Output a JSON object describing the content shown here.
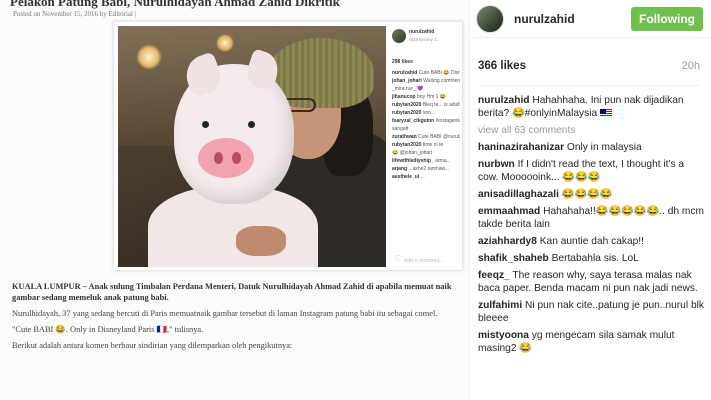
{
  "article": {
    "headline_partial": "Pelakon Patung Babi, Nurulhidayah Ahmad Zahid Dikritik",
    "posted": "Posted on November 15, 2016 by Editorial |",
    "paragraphs": [
      "KUALA LUMPUR – Anak sulung Timbalan Perdana Menteri, Datuk Nurulhidayah Ahmad Zahid di apabila memuat naik gambar sedang memeluk anak patung babi.",
      "Nurulhidayah, 37 yang sedang bercuti di Paris memuatnaik gambar tersebut di laman Instagram patung babi itu sebagai comel.",
      "\"Cute BABI 😂. Only in Disneyland Paris 🇫🇷,\" tulisnya.",
      "Berikut adalah antara komen berbaur sindirian yang dilemparkan oleh pengikutnya:"
    ]
  },
  "embedded_post": {
    "username": "nurulzahid",
    "location": "Walt Disney S...",
    "likes": "298 likes",
    "comments": [
      {
        "u": "nurulzahid",
        "t": "Cute BABI 😂 Disneyland Paris re..."
      },
      {
        "u": "johan_johari",
        "t": "Waiting comments in 3, 2, 1..."
      },
      {
        "u": "",
        "t": "_mira.nur_ 💜"
      },
      {
        "u": "jihanucop",
        "t": "boy Hm 1 😂"
      },
      {
        "u": "rubytan2020",
        "t": "Bleq te... is adult"
      },
      {
        "u": "rubytan2020",
        "t": "soo..."
      },
      {
        "u": "fsaryzal_ctkguinn",
        "t": "#instagenius academ..."
      },
      {
        "u": "",
        "t": "sangatt"
      },
      {
        "u": "zurathwan",
        "t": "Cute BABI @nurulzahid"
      },
      {
        "u": "rubytan2020",
        "t": "time ni te"
      },
      {
        "u": "",
        "t": "😂 @johan_johari"
      },
      {
        "u": "lifewithlediyship_",
        "t": "arma..."
      },
      {
        "u": "arjang",
        "t": "...akhe2 tanmaw..."
      },
      {
        "u": "aesthele_ul",
        "t": "..."
      }
    ],
    "add_comment": "Add a comment..."
  },
  "header": {
    "username": "nurulzahid",
    "follow_label": "Following"
  },
  "post": {
    "likes": "366 likes",
    "time": "20h",
    "view_all": "view all 63 comments"
  },
  "comments": [
    {
      "user": "nurulzahid",
      "text": "Hahahhaha. Ini pun nak dijadikan berita? 😂#onlyinMalaysia",
      "flag": true
    },
    {
      "user": "haninazirahanizar",
      "text": "Only in malaysia"
    },
    {
      "user": "nurbwn",
      "text": "If I didn't read the text, I thought it's a cow. Moooooink... 😂😂😂"
    },
    {
      "user": "anisadillaghazali",
      "text": "😂😂😂😂"
    },
    {
      "user": "emmaahmad",
      "text": "Hahahaha!!😂😂😂😂😂.. dh mcm takde berita lain"
    },
    {
      "user": "aziahhardy8",
      "text": "Kan auntie dah cakap!!"
    },
    {
      "user": "shafik_shaheb",
      "text": "Bertabahla sis. LoL"
    },
    {
      "user": "feeqz_",
      "text": "The reason why, saya terasa malas nak baca paper. Benda macam ni pun nak jadi news."
    },
    {
      "user": "zulfahimi",
      "text": "Ni pun nak cite..patung je pun..nurul blk bleeee"
    },
    {
      "user": "mistyoona",
      "text": "yg mengecam sila samak mulut masing2 😂"
    }
  ],
  "colors": {
    "follow_button": "#70c050",
    "muted_text": "#999999",
    "text": "#262626"
  }
}
